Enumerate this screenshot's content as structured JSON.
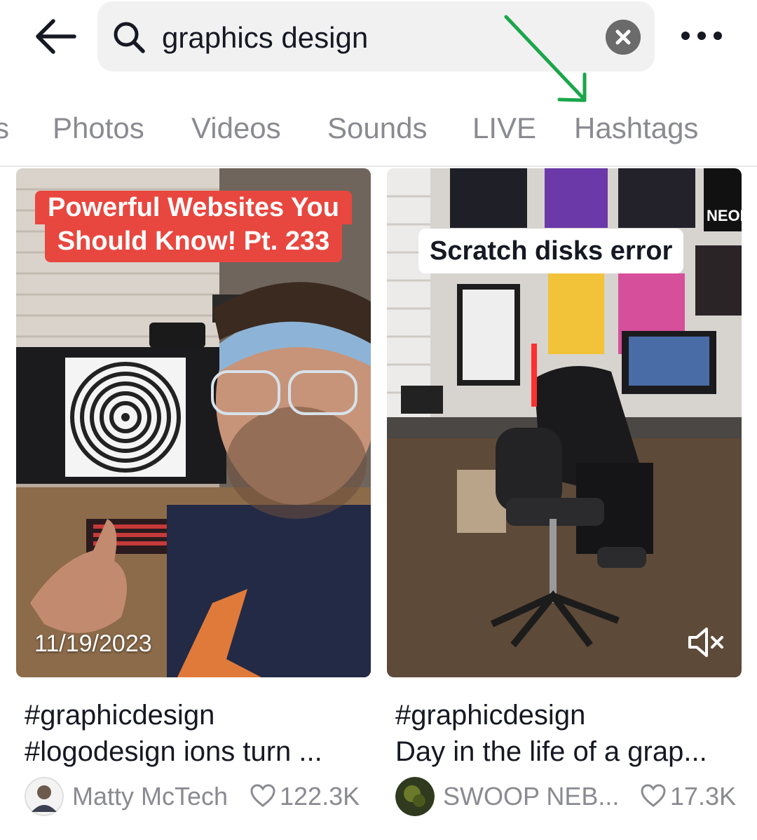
{
  "search": {
    "query": "graphics design"
  },
  "tabs": [
    "s",
    "Photos",
    "Videos",
    "Sounds",
    "LIVE",
    "Hashtags"
  ],
  "results": [
    {
      "overlay_line1": "Powerful Websites You",
      "overlay_line2": "Should Know! Pt. 233",
      "date": "11/19/2023",
      "desc_line1": "#graphicdesign",
      "desc_line2": "#logodesign ions turn ...",
      "author": "Matty McTech",
      "likes": "122.3K"
    },
    {
      "overlay_line1": "Scratch disks error",
      "poster_text": "NEON",
      "desc_line1": "#graphicdesign",
      "desc_line2": "Day in the life of a grap...",
      "author": "SWOOP NEB...",
      "likes": "17.3K"
    }
  ],
  "colors": {
    "overlay_red": "#e8473f",
    "annotation_arrow": "#1aa64a",
    "muted_text": "#8a8b91"
  },
  "icons": [
    "back-arrow-icon",
    "search-icon",
    "clear-icon",
    "more-icon",
    "heart-icon",
    "mute-icon"
  ]
}
